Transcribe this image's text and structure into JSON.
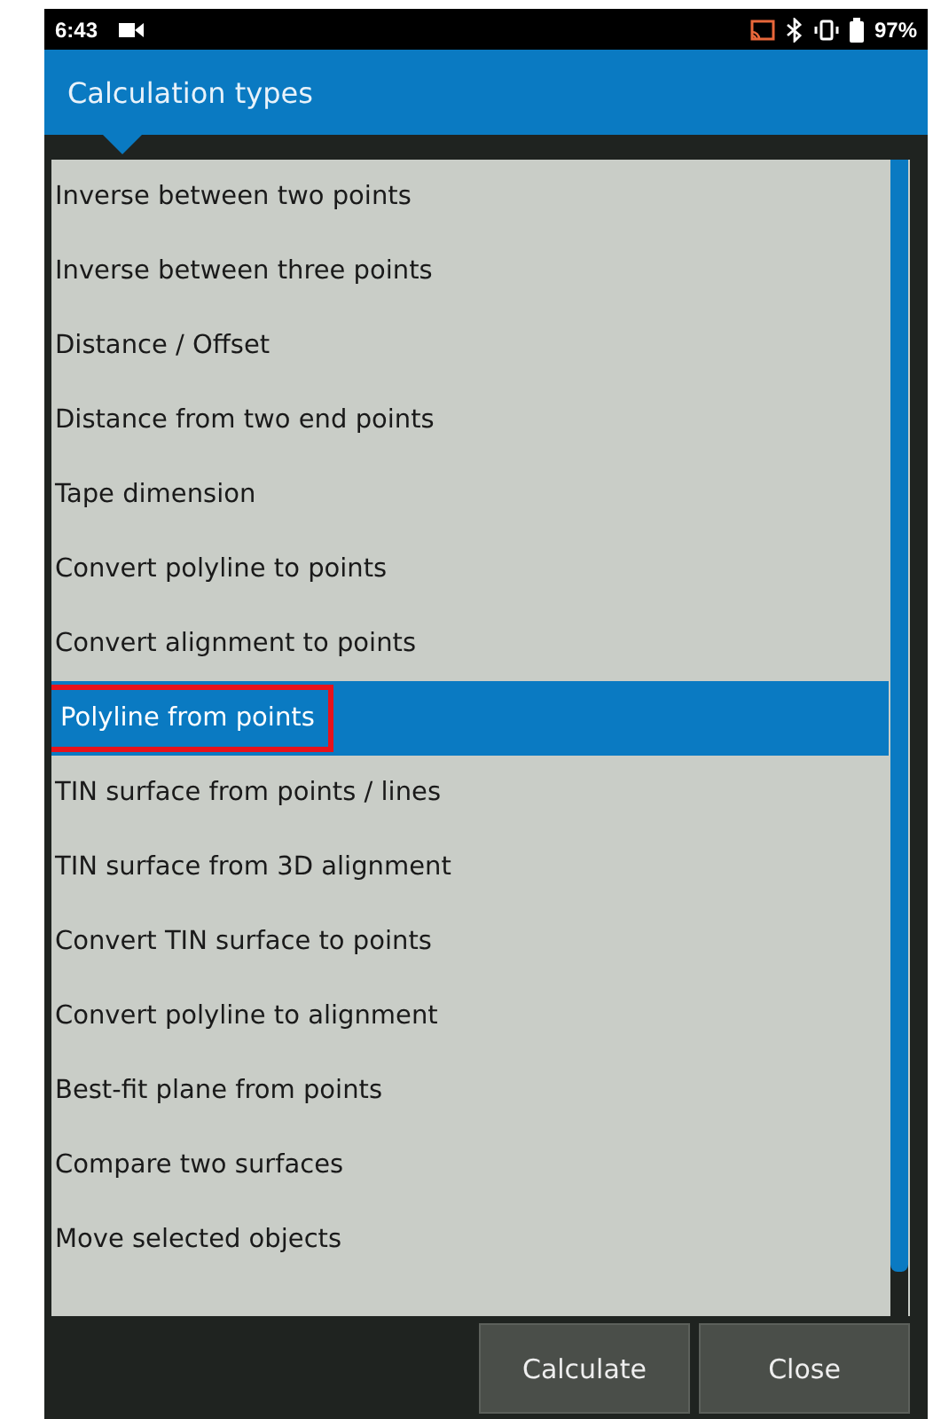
{
  "status_bar": {
    "time": "6:43",
    "battery": "97%"
  },
  "header": {
    "title": "Calculation types"
  },
  "items": [
    {
      "label": "Inverse between two points",
      "selected": false,
      "highlighted": false
    },
    {
      "label": "Inverse between three points",
      "selected": false,
      "highlighted": false
    },
    {
      "label": "Distance / Offset",
      "selected": false,
      "highlighted": false
    },
    {
      "label": "Distance from two end points",
      "selected": false,
      "highlighted": false
    },
    {
      "label": "Tape dimension",
      "selected": false,
      "highlighted": false
    },
    {
      "label": "Convert polyline to points",
      "selected": false,
      "highlighted": false
    },
    {
      "label": "Convert alignment to points",
      "selected": false,
      "highlighted": false
    },
    {
      "label": "Polyline from points",
      "selected": true,
      "highlighted": true
    },
    {
      "label": "TIN surface from points / lines",
      "selected": false,
      "highlighted": false
    },
    {
      "label": "TIN surface from 3D alignment",
      "selected": false,
      "highlighted": false
    },
    {
      "label": "Convert TIN surface to points",
      "selected": false,
      "highlighted": false
    },
    {
      "label": "Convert polyline to alignment",
      "selected": false,
      "highlighted": false
    },
    {
      "label": "Best-fit plane from points",
      "selected": false,
      "highlighted": false
    },
    {
      "label": "Compare two surfaces",
      "selected": false,
      "highlighted": false
    },
    {
      "label": "Move selected objects",
      "selected": false,
      "highlighted": false
    }
  ],
  "buttons": [
    "Calculate",
    "Close"
  ]
}
